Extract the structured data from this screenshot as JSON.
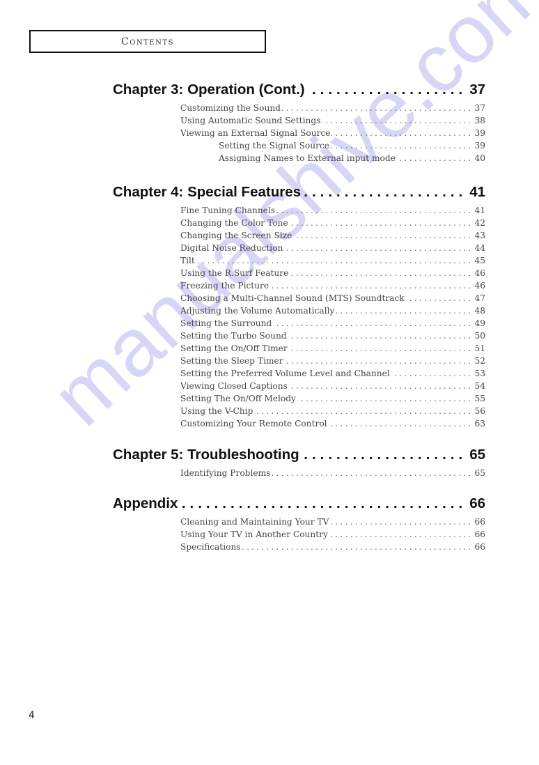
{
  "header": {
    "title": "Contents"
  },
  "watermark": {
    "text": "manualshive.com",
    "color": "#c9c9f5"
  },
  "chapters": [
    {
      "title": "Chapter 3: Operation (Cont.)",
      "page": "37",
      "entries": [
        {
          "label": "Customizing the Sound",
          "page": "37",
          "level": 1
        },
        {
          "label": "Using Automatic Sound Settings",
          "page": "38",
          "level": 1
        },
        {
          "label": "Viewing an External Signal Source",
          "page": "39",
          "level": 1
        },
        {
          "label": "Setting the Signal Source",
          "page": "39",
          "level": 2
        },
        {
          "label": "Assigning Names to External input mode",
          "page": "40",
          "level": 2
        }
      ]
    },
    {
      "title": "Chapter 4: Special Features",
      "page": "41",
      "entries": [
        {
          "label": "Fine Tuning Channels",
          "page": "41",
          "level": 1
        },
        {
          "label": "Changing the Color Tone",
          "page": "42",
          "level": 1
        },
        {
          "label": "Changing the Screen Size",
          "page": "43",
          "level": 1
        },
        {
          "label": "Digital Noise Reduction",
          "page": "44",
          "level": 1
        },
        {
          "label": "Tilt",
          "page": "45",
          "level": 1
        },
        {
          "label": "Using the R.Surf Feature",
          "page": "46",
          "level": 1
        },
        {
          "label": "Freezing the Picture",
          "page": "46",
          "level": 1
        },
        {
          "label": "Choosing a Multi-Channel Sound (MTS) Soundtrack",
          "page": "47",
          "level": 1
        },
        {
          "label": "Adjusting the Volume Automatically",
          "page": "48",
          "level": 1
        },
        {
          "label": "Setting the Surround",
          "page": "49",
          "level": 1
        },
        {
          "label": "Setting the Turbo Sound",
          "page": "50",
          "level": 1
        },
        {
          "label": "Setting the On/Off Timer",
          "page": "51",
          "level": 1
        },
        {
          "label": "Setting the Sleep Timer",
          "page": "52",
          "level": 1
        },
        {
          "label": "Setting the Preferred Volume Level and Channel",
          "page": "53",
          "level": 1
        },
        {
          "label": "Viewing Closed Captions",
          "page": "54",
          "level": 1
        },
        {
          "label": "Setting The On/Off Melody",
          "page": "55",
          "level": 1
        },
        {
          "label": "Using the V-Chip",
          "page": "56",
          "level": 1
        },
        {
          "label": "Customizing Your Remote Control",
          "page": "63",
          "level": 1
        }
      ]
    },
    {
      "title": "Chapter 5: Troubleshooting",
      "page": "65",
      "entries": [
        {
          "label": "Identifying Problems",
          "page": "65",
          "level": 1
        }
      ]
    },
    {
      "title": "Appendix",
      "page": "66",
      "entries": [
        {
          "label": "Cleaning and Maintaining Your TV",
          "page": "66",
          "level": 1
        },
        {
          "label": "Using Your TV in Another Country",
          "page": "66",
          "level": 1
        },
        {
          "label": "Specifications",
          "page": "66",
          "level": 1
        }
      ]
    }
  ],
  "footer": {
    "page_number": "4"
  }
}
